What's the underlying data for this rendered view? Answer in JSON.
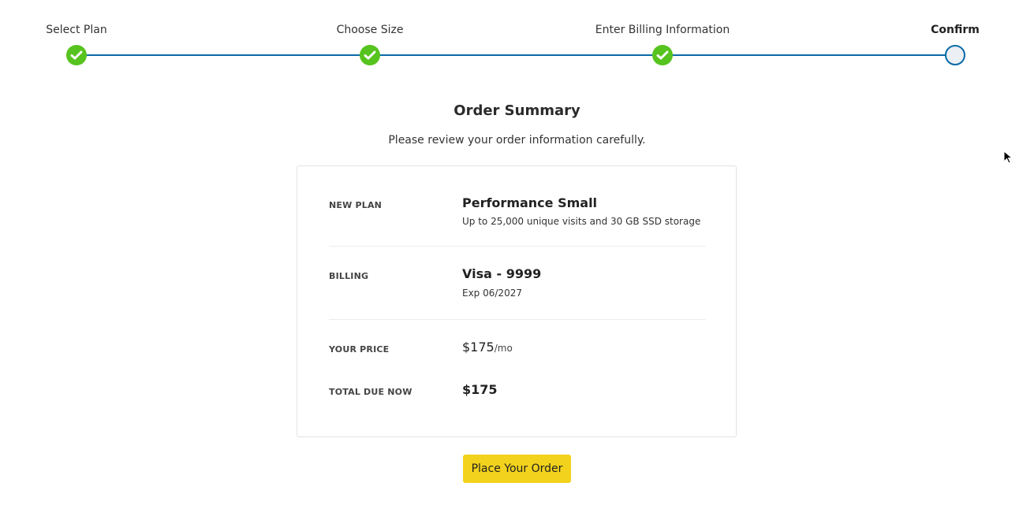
{
  "stepper": {
    "steps": [
      {
        "label": "Select Plan",
        "state": "done"
      },
      {
        "label": "Choose Size",
        "state": "done"
      },
      {
        "label": "Enter Billing Information",
        "state": "done"
      },
      {
        "label": "Confirm",
        "state": "current"
      }
    ],
    "colors": {
      "done": "#56c31e",
      "line": "#0a6aa8"
    }
  },
  "summary": {
    "title": "Order Summary",
    "subtitle": "Please review your order information carefully."
  },
  "plan": {
    "label": "NEW PLAN",
    "name": "Performance Small",
    "description": "Up to 25,000 unique visits and 30 GB SSD storage"
  },
  "billing": {
    "label": "BILLING",
    "card": "Visa - 9999",
    "expiry": "Exp 06/2027"
  },
  "price": {
    "label": "YOUR PRICE",
    "amount": "$175",
    "unit": "/mo"
  },
  "total": {
    "label": "TOTAL DUE NOW",
    "amount": "$175"
  },
  "actions": {
    "place_order": "Place Your Order",
    "button_color": "#f2d21c"
  }
}
